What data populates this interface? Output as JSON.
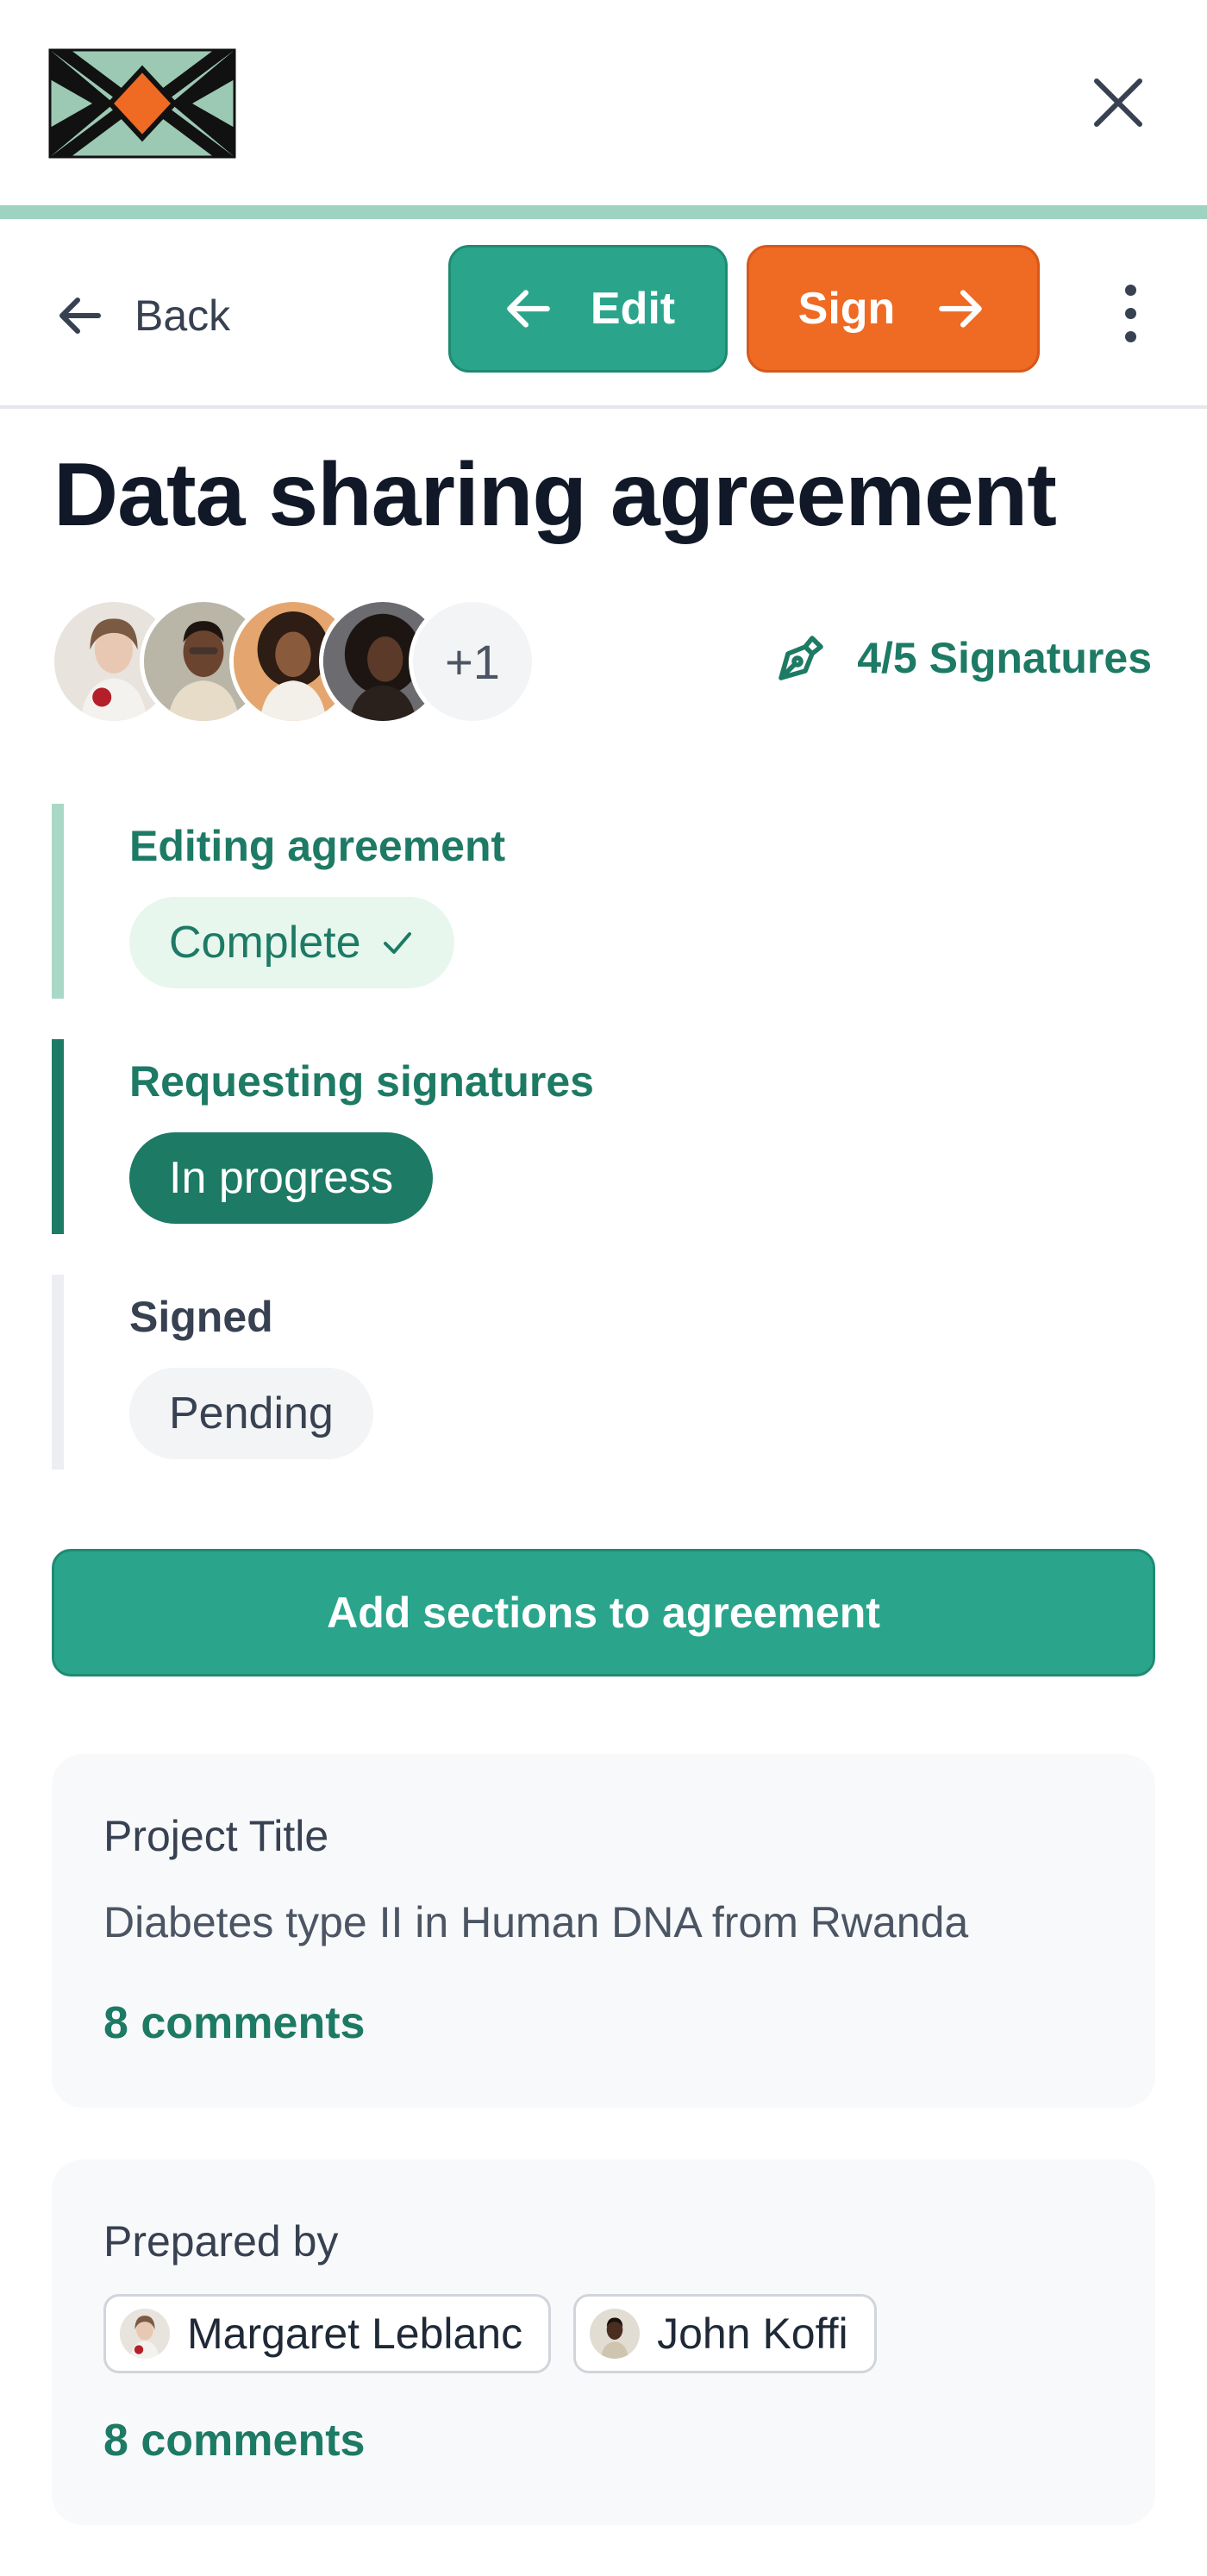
{
  "header": {
    "logo_icon": "diamond-pattern-logo",
    "close_icon": "close-icon"
  },
  "toolbar": {
    "back_label": "Back",
    "edit_label": "Edit",
    "sign_label": "Sign",
    "more_icon": "kebab-menu-icon"
  },
  "agreement": {
    "title": "Data sharing agreement",
    "extra_signers": "+1",
    "signatures_label": "4/5 Signatures"
  },
  "steps": [
    {
      "title": "Editing agreement",
      "status": "Complete",
      "check": "✓"
    },
    {
      "title": "Requesting signatures",
      "status": "In progress"
    },
    {
      "title": "Signed",
      "status": "Pending"
    }
  ],
  "actions": {
    "add_sections_label": "Add sections to agreement"
  },
  "cards": {
    "project": {
      "label": "Project Title",
      "value": "Diabetes type II in Human DNA from Rwanda",
      "comments": "8 comments"
    },
    "prepared": {
      "label": "Prepared by",
      "people": [
        "Margaret Leblanc",
        "John Koffi"
      ],
      "comments": "8 comments"
    }
  },
  "colors": {
    "primary_green": "#2aa58c",
    "dark_green": "#1d7a64",
    "accent_orange": "#ef6a22",
    "accent_bar": "#9dd3c0"
  }
}
